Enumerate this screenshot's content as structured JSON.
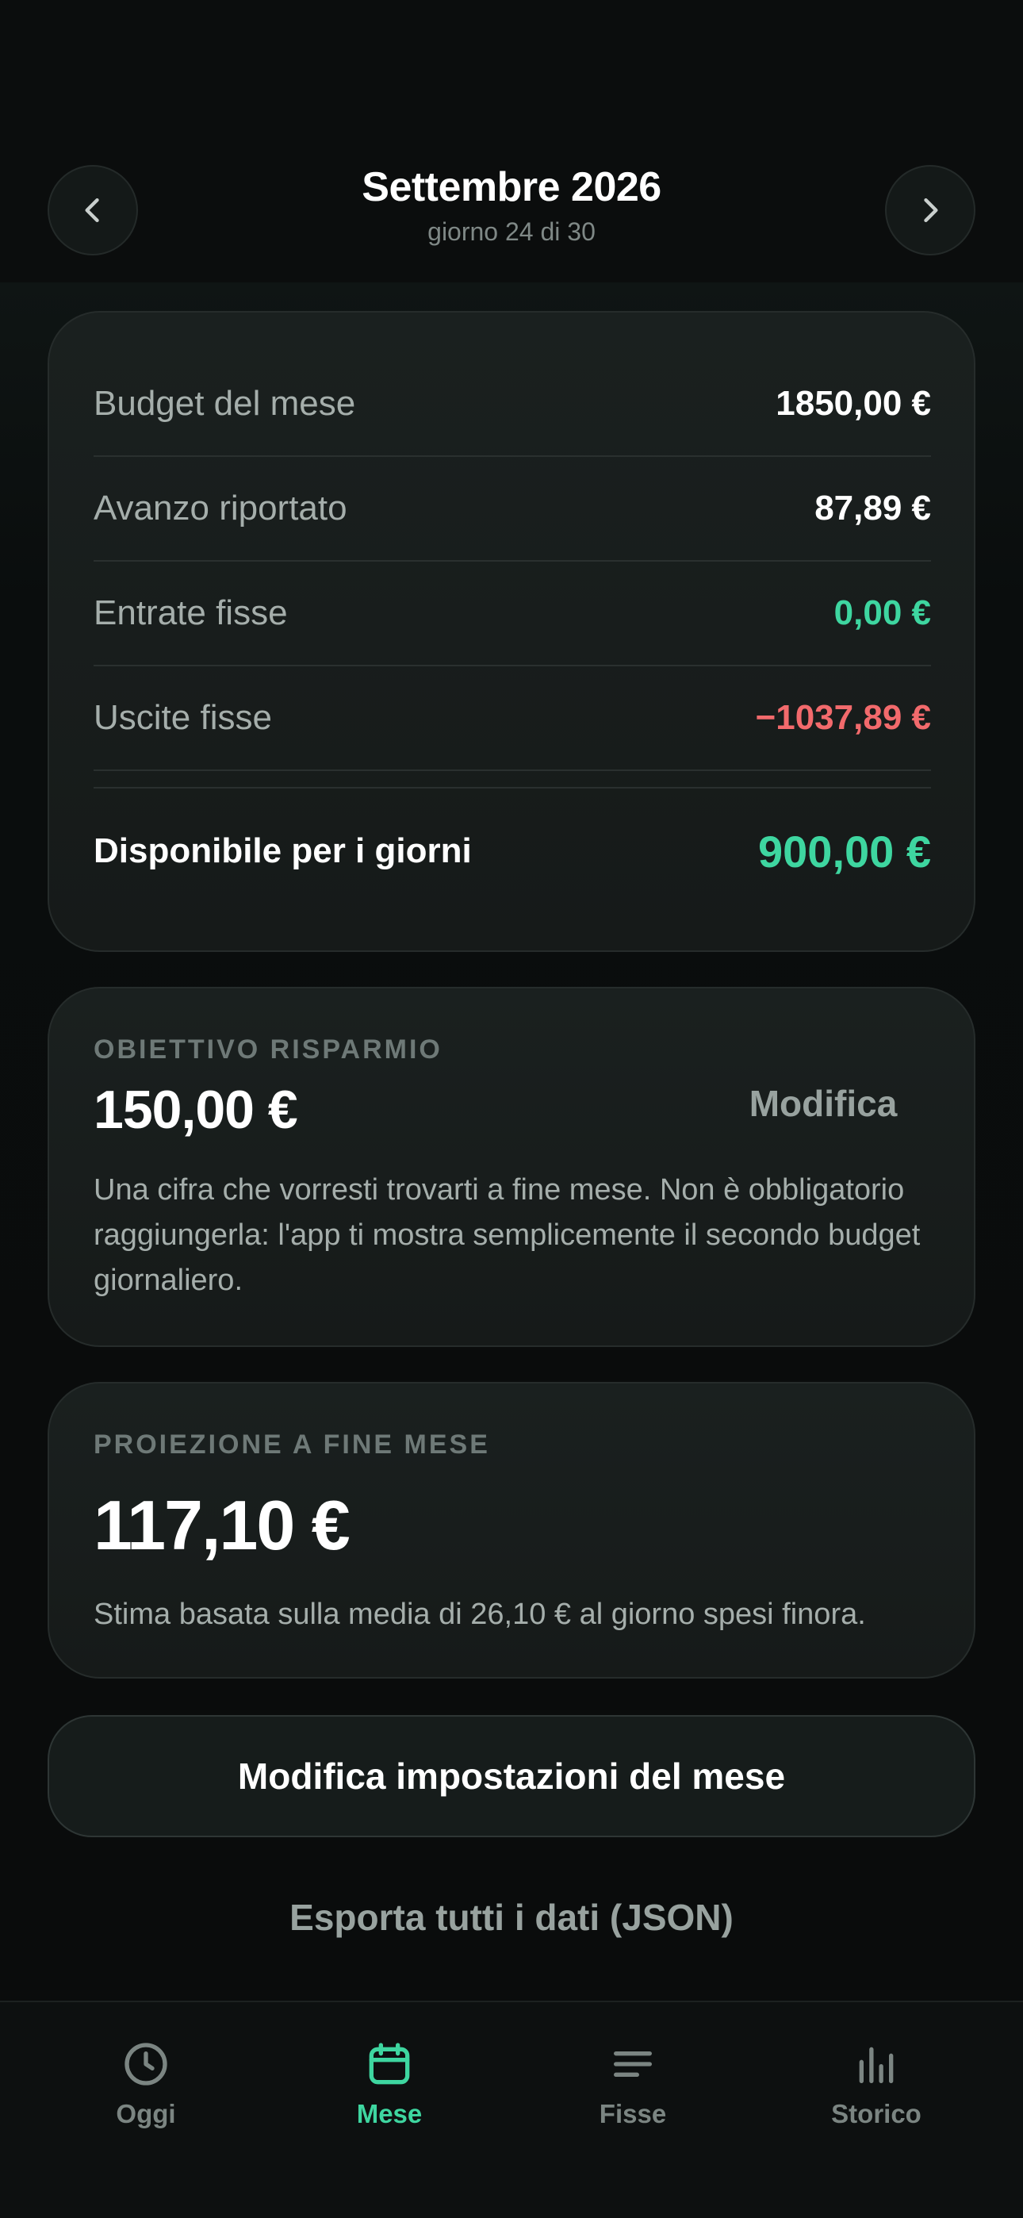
{
  "header": {
    "title": "Settembre 2026",
    "subtitle": "giorno 24 di 30",
    "prev_icon": "chevron-left-icon",
    "next_icon": "chevron-right-icon"
  },
  "summary": {
    "rows": [
      {
        "label": "Budget del mese",
        "value": "1850,00 €"
      },
      {
        "label": "Avanzo riportato",
        "value": "87,89 €"
      },
      {
        "label": "Entrate fisse",
        "value": "0,00 €"
      },
      {
        "label": "Uscite fisse",
        "value": "−1037,89 €"
      }
    ],
    "total_label": "Disponibile per i giorni",
    "total_value": "900,00 €"
  },
  "goal": {
    "label": "OBIETTIVO RISPARMIO",
    "amount": "150,00 €",
    "edit_label": "Modifica",
    "description": "Una cifra che vorresti trovarti a fine mese. Non è obbligatorio raggiungerla: l'app ti mostra semplicemente il secondo budget giornaliero."
  },
  "projection": {
    "label": "PROIEZIONE A FINE MESE",
    "amount": "117,10 €",
    "description": "Stima basata sulla media di 26,10 € al giorno spesi finora."
  },
  "actions": {
    "edit_month": "Modifica impostazioni del mese",
    "export": "Esporta tutti i dati (JSON)"
  },
  "tabbar": {
    "tabs": [
      {
        "label": "Oggi",
        "icon": "clock-icon",
        "active": false
      },
      {
        "label": "Mese",
        "icon": "calendar-icon",
        "active": true
      },
      {
        "label": "Fisse",
        "icon": "list-lines-icon",
        "active": false
      },
      {
        "label": "Storico",
        "icon": "bar-chart-icon",
        "active": false
      }
    ]
  },
  "colors": {
    "accent": "#3ed6a0",
    "negative": "#f26a6c",
    "background": "#0a0c0c",
    "card": "#1a201f"
  }
}
